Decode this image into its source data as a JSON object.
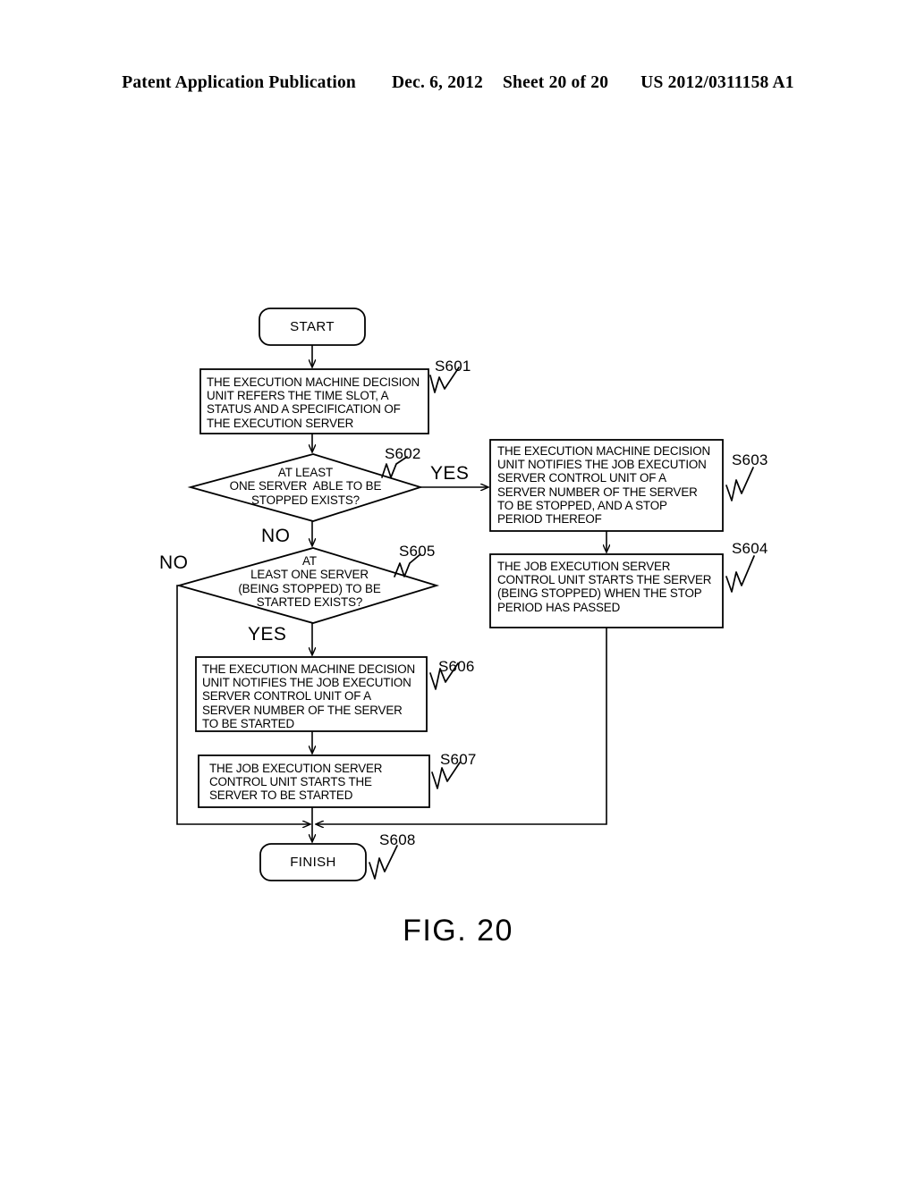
{
  "header": {
    "publication": "Patent Application Publication",
    "date": "Dec. 6, 2012",
    "sheet": "Sheet 20 of 20",
    "pub_number": "US 2012/0311158 A1"
  },
  "figure": {
    "caption": "FIG. 20"
  },
  "flowchart": {
    "start": {
      "label": "START"
    },
    "finish": {
      "label": "FINISH",
      "step": "S608"
    },
    "steps": [
      {
        "id": "S601",
        "step": "S601",
        "type": "process",
        "text": "THE EXECUTION MACHINE DECISION\nUNIT REFERS THE TIME SLOT, A\nSTATUS AND A SPECIFICATION OF\nTHE EXECUTION SERVER"
      },
      {
        "id": "S602",
        "step": "S602",
        "type": "decision",
        "text": "AT LEAST\nONE SERVER  ABLE TO BE\nSTOPPED EXISTS?",
        "yes_label": "YES",
        "no_label": "NO"
      },
      {
        "id": "S603",
        "step": "S603",
        "type": "process",
        "text": "THE EXECUTION MACHINE DECISION\nUNIT NOTIFIES THE JOB EXECUTION\nSERVER CONTROL UNIT OF A\nSERVER NUMBER OF THE SERVER\nTO BE STOPPED, AND A STOP\nPERIOD THEREOF"
      },
      {
        "id": "S604",
        "step": "S604",
        "type": "process",
        "text": "THE JOB EXECUTION SERVER\nCONTROL UNIT STARTS THE SERVER\n(BEING STOPPED) WHEN THE STOP\nPERIOD HAS PASSED"
      },
      {
        "id": "S605",
        "step": "S605",
        "type": "decision",
        "text": "AT\nLEAST ONE SERVER\n(BEING STOPPED) TO BE\nSTARTED EXISTS?",
        "yes_label": "YES",
        "no_label": "NO"
      },
      {
        "id": "S606",
        "step": "S606",
        "type": "process",
        "text": "THE EXECUTION MACHINE DECISION\nUNIT NOTIFIES THE JOB EXECUTION\nSERVER CONTROL UNIT OF A\nSERVER NUMBER OF THE SERVER\nTO BE STARTED"
      },
      {
        "id": "S607",
        "step": "S607",
        "type": "process",
        "text": "THE JOB EXECUTION SERVER\nCONTROL UNIT STARTS THE\nSERVER TO BE STARTED"
      }
    ]
  },
  "colors": {
    "ink": "#000000",
    "paper": "#ffffff"
  }
}
